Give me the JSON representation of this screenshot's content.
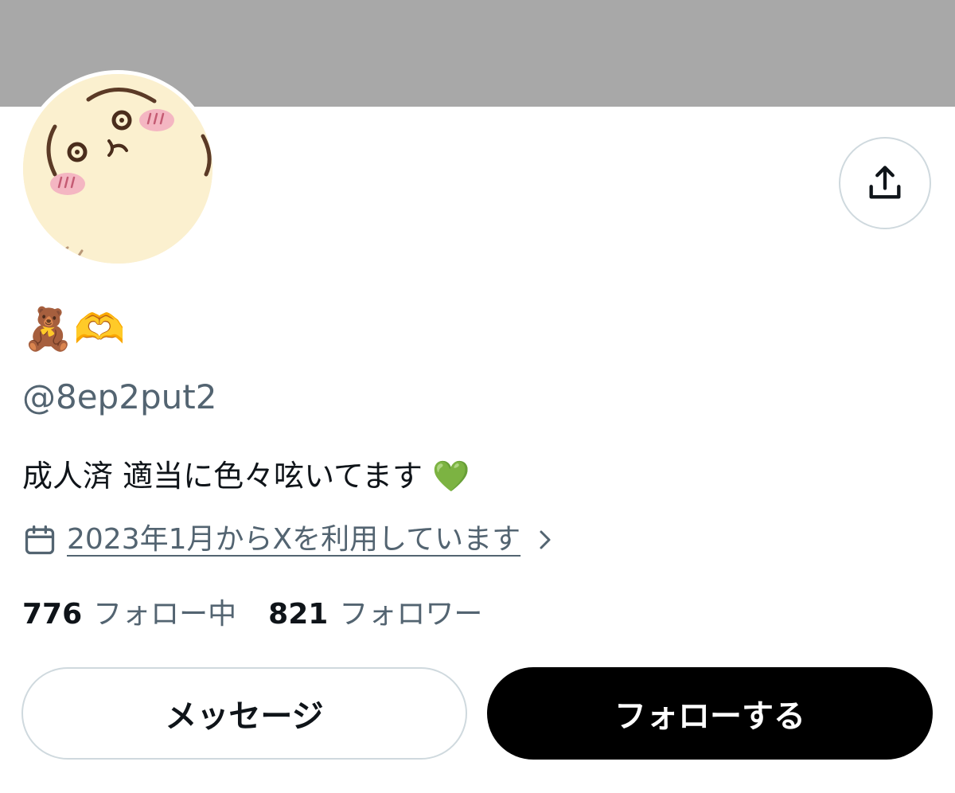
{
  "profile": {
    "display_name": "🧸🫶",
    "handle": "@8ep2put2",
    "bio": "成人済 適当に色々呟いてます 💚",
    "joined": "2023年1月からXを利用しています"
  },
  "stats": {
    "following_count": "776",
    "following_label": "フォロー中",
    "followers_count": "821",
    "followers_label": "フォロワー"
  },
  "actions": {
    "message_label": "メッセージ",
    "follow_label": "フォローする"
  },
  "icons": {
    "share": "share-icon",
    "calendar": "calendar-icon",
    "chevron": "chevron-right-icon"
  },
  "colors": {
    "banner": "#a8a8a8",
    "secondary_text": "#536471",
    "follow_button": "#000000"
  }
}
